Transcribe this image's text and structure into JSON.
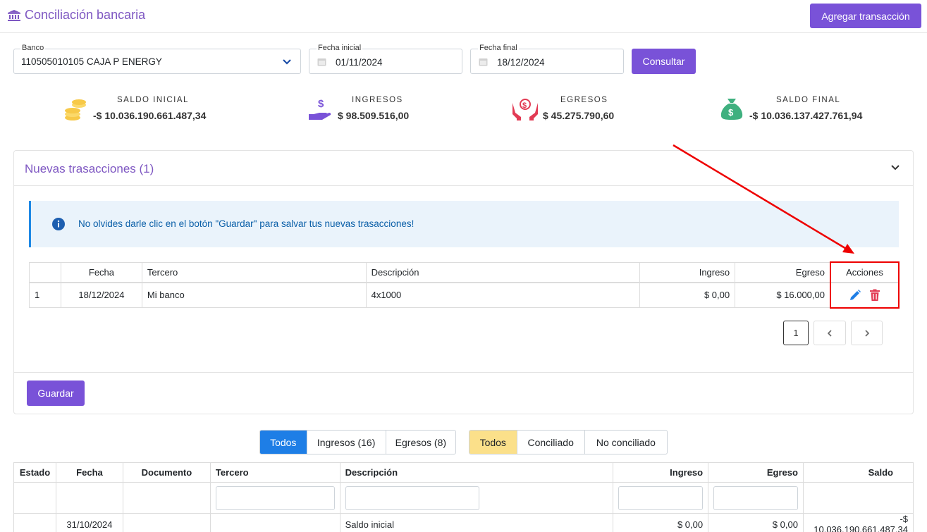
{
  "header": {
    "title": "Conciliación bancaria",
    "add_button": "Agregar transacción"
  },
  "filters": {
    "bank_label": "Banco",
    "bank_value": "110505010105 CAJA P ENERGY",
    "start_label": "Fecha inicial",
    "start_value": "01/11/2024",
    "end_label": "Fecha final",
    "end_value": "18/12/2024",
    "submit": "Consultar"
  },
  "stats": [
    {
      "label": "SALDO INICIAL",
      "value": "-$ 10.036.190.661.487,34",
      "icon": "coins-icon",
      "color": "#f7c948"
    },
    {
      "label": "INGRESOS",
      "value": "$ 98.509.516,00",
      "icon": "hand-dollar-icon",
      "color": "#7952d8"
    },
    {
      "label": "EGRESOS",
      "value": "$ 45.275.790,60",
      "icon": "hands-dollar-icon",
      "color": "#e23b54"
    },
    {
      "label": "SALDO FINAL",
      "value": "-$ 10.036.137.427.761,94",
      "icon": "money-bag-icon",
      "color": "#3fb07f"
    }
  ],
  "panel": {
    "title": "Nuevas trasacciones (1)",
    "alert": "No olvides darle clic en el botón \"Guardar\" para salvar tus nuevas trasacciones!",
    "columns": [
      "",
      "Fecha",
      "Tercero",
      "Descripción",
      "Ingreso",
      "Egreso",
      "Acciones"
    ],
    "rows": [
      {
        "n": "1",
        "fecha": "18/12/2024",
        "tercero": "Mi banco",
        "descripcion": "4x1000",
        "ingreso": "$ 0,00",
        "egreso": "$ 16.000,00"
      }
    ],
    "page": "1",
    "save": "Guardar"
  },
  "type_filter": {
    "all": "Todos",
    "income": "Ingresos (16)",
    "expense": "Egresos (8)",
    "active_color": "#1e7ee6"
  },
  "status_filter": {
    "all": "Todos",
    "reconciled": "Conciliado",
    "not_reconciled": "No conciliado",
    "active_color": "#fbe08a"
  },
  "main_table": {
    "columns": [
      "Estado",
      "Fecha",
      "Documento",
      "Tercero",
      "Descripción",
      "Ingreso",
      "Egreso",
      "Saldo"
    ],
    "rows": [
      {
        "estado": "",
        "fecha": "31/10/2024",
        "documento": "",
        "tercero": "",
        "descripcion": "Saldo inicial",
        "ingreso": "$ 0,00",
        "egreso": "$ 0,00",
        "saldo": "-$ 10.036.190.661.487,34"
      }
    ]
  }
}
